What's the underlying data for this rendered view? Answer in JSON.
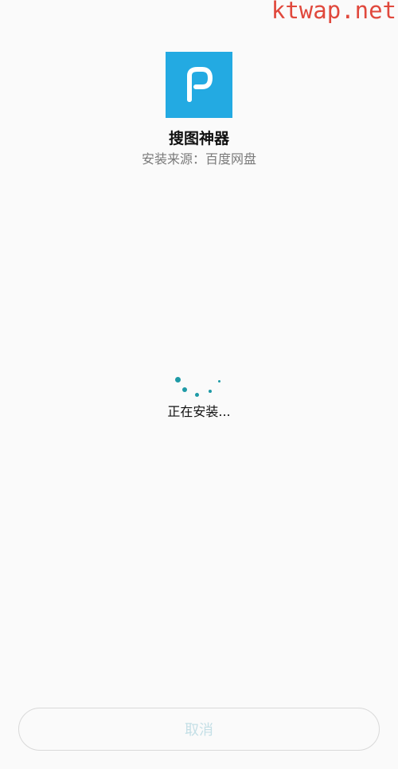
{
  "watermark": "ktwap.net",
  "app": {
    "name": "搜图神器",
    "source": "安装来源：百度网盘",
    "icon": "baidu-netdisk-p-icon",
    "icon_color": "#23aae2"
  },
  "status": {
    "text": "正在安装...",
    "spinner_color": "#1e9aa6"
  },
  "actions": {
    "cancel_label": "取消"
  }
}
